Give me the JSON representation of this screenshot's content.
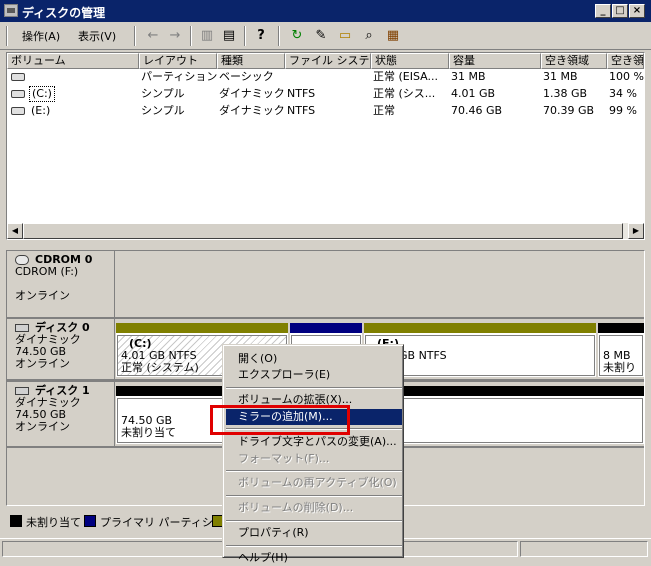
{
  "window": {
    "title": "ディスクの管理"
  },
  "menu": {
    "action": "操作(A)",
    "view": "表示(V)"
  },
  "toolbar": {
    "back": "←",
    "forward": "→",
    "tree": "▥",
    "props": "▤",
    "help": "?",
    "refresh": "↻",
    "rescan": "✎",
    "open": "▭",
    "search": "⌕",
    "config": "▦"
  },
  "volume_list": {
    "columns": [
      "ボリューム",
      "レイアウト",
      "種類",
      "ファイル システ...",
      "状態",
      "容量",
      "空き領域",
      "空き領"
    ],
    "rows": [
      [
        "",
        "パーティション",
        "ベーシック",
        "",
        "正常 (EISA...",
        "31 MB",
        "31 MB",
        "100 %"
      ],
      [
        "(C:)",
        "シンプル",
        "ダイナミック",
        "NTFS",
        "正常 (シス...",
        "4.01 GB",
        "1.38 GB",
        "34 %"
      ],
      [
        "(E:)",
        "シンプル",
        "ダイナミック",
        "NTFS",
        "正常",
        "70.46 GB",
        "70.39 GB",
        "99 %"
      ]
    ]
  },
  "scrollbar": {
    "left_arrow": "◀",
    "right_arrow": "▶"
  },
  "disks": {
    "cdrom": {
      "name": "CDROM 0",
      "type": "CDROM (F:)",
      "status": "オンライン"
    },
    "disk0": {
      "name": "ディスク 0",
      "type": "ダイナミック",
      "size": "74.50 GB",
      "status": "オンライン",
      "partitions": [
        {
          "label": "(C:)",
          "line1": "4.01 GB NTFS",
          "line2": "正常 (システム)"
        },
        {
          "label": "",
          "line1": "",
          "line2": ""
        },
        {
          "label": "(E:)",
          "line1": "GB NTFS",
          "line2": ""
        },
        {
          "label": "",
          "line1": "8 MB",
          "line2": "未割り"
        }
      ]
    },
    "disk1": {
      "name": "ディスク 1",
      "type": "ダイナミック",
      "size": "74.50 GB",
      "status": "オンライン",
      "partition": {
        "line1": "74.50 GB",
        "line2": "未割り当て"
      }
    }
  },
  "legend": {
    "unallocated": "未割り当て",
    "primary": "プライマリ パーティション"
  },
  "context_menu": {
    "items": [
      {
        "label": "開く(O)",
        "state": "normal"
      },
      {
        "label": "エクスプローラ(E)",
        "state": "normal"
      },
      {
        "label": "ボリュームの拡張(X)...",
        "state": "normal"
      },
      {
        "label": "ミラーの追加(M)...",
        "state": "highlighted"
      },
      {
        "label": "ドライブ文字とパスの変更(A)...",
        "state": "normal"
      },
      {
        "label": "フォーマット(F)...",
        "state": "disabled"
      },
      {
        "label": "ボリュームの再アクティブ化(O)",
        "state": "disabled"
      },
      {
        "label": "ボリュームの削除(D)...",
        "state": "disabled"
      },
      {
        "label": "プロパティ(R)",
        "state": "normal"
      },
      {
        "label": "ヘルプ(H)",
        "state": "normal"
      }
    ]
  },
  "colors": {
    "titlebar": "#0a246a",
    "primary_partition": "#000080",
    "unallocated": "#000000",
    "simple_volume": "#808000",
    "highlight": "#0a246a",
    "annotation": "#e00000"
  }
}
